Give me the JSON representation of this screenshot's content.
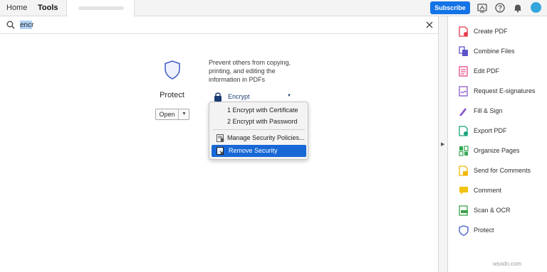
{
  "topbar": {
    "tabs": [
      {
        "label": "Home"
      },
      {
        "label": "Tools"
      }
    ],
    "subscribe_label": "Subscribe"
  },
  "search": {
    "value": "encr",
    "placeholder": ""
  },
  "tool_card": {
    "name": "Protect",
    "open_label": "Open",
    "description": "Prevent others from copying, printing, and editing the information in PDFs",
    "action_label": "Encrypt"
  },
  "menu": {
    "items": [
      {
        "label": "1 Encrypt with Certificate"
      },
      {
        "label": "2 Encrypt with Password"
      },
      {
        "label": "Manage Security Policies..."
      },
      {
        "label": "Remove Security"
      }
    ]
  },
  "tools_panel": {
    "items": [
      {
        "label": "Create PDF",
        "icon": "create-pdf-icon",
        "color": "#e8394b"
      },
      {
        "label": "Combine Files",
        "icon": "combine-files-icon",
        "color": "#5c56c9"
      },
      {
        "label": "Edit PDF",
        "icon": "edit-pdf-icon",
        "color": "#e34989"
      },
      {
        "label": "Request E-signatures",
        "icon": "request-esignatures-icon",
        "color": "#8b59c9"
      },
      {
        "label": "Fill & Sign",
        "icon": "fill-sign-icon",
        "color": "#8b59c9"
      },
      {
        "label": "Export PDF",
        "icon": "export-pdf-icon",
        "color": "#1aa27b"
      },
      {
        "label": "Organize Pages",
        "icon": "organize-pages-icon",
        "color": "#34a853"
      },
      {
        "label": "Send for Comments",
        "icon": "send-for-comments-icon",
        "color": "#f0b90b"
      },
      {
        "label": "Comment",
        "icon": "comment-icon",
        "color": "#f0c20b"
      },
      {
        "label": "Scan & OCR",
        "icon": "scan-ocr-icon",
        "color": "#3ca04a"
      },
      {
        "label": "Protect",
        "icon": "protect-icon",
        "color": "#4a63c9"
      }
    ]
  },
  "colors": {
    "accent": "#1473e6",
    "menu_highlight": "#1768d6"
  },
  "watermark": "wsxdn.com"
}
